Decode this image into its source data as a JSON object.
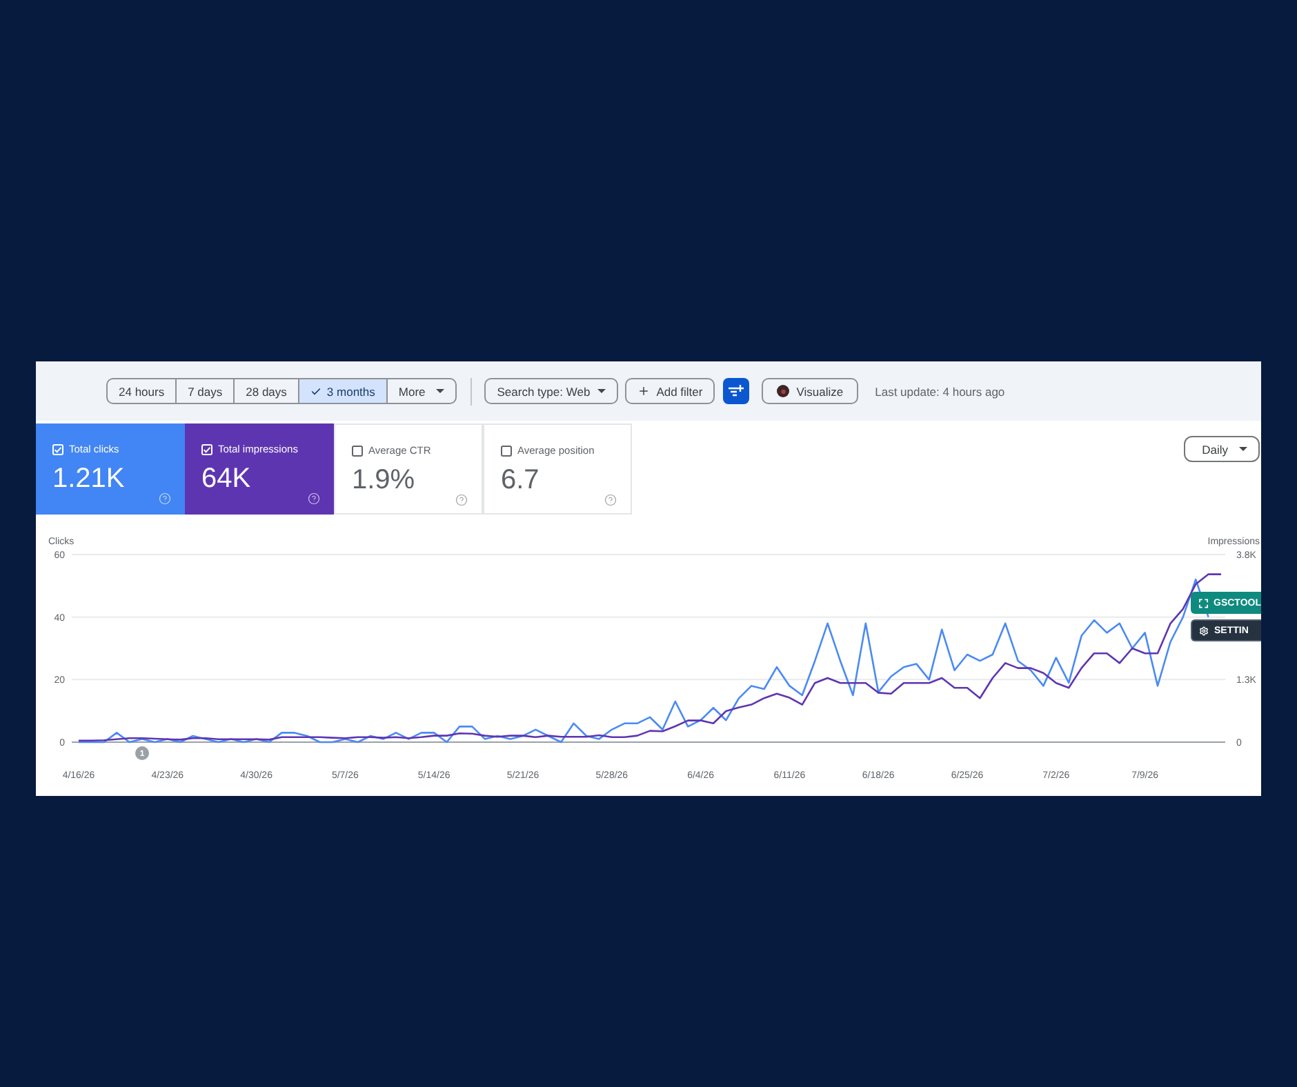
{
  "toolbar": {
    "ranges": [
      {
        "label": "24 hours",
        "selected": false
      },
      {
        "label": "7 days",
        "selected": false
      },
      {
        "label": "28 days",
        "selected": false
      },
      {
        "label": "3 months",
        "selected": true
      }
    ],
    "more": "More",
    "search_type": "Search type: Web",
    "add_filter": "Add filter",
    "visualize": "Visualize",
    "last_update": "Last update: 4 hours ago"
  },
  "metrics": [
    {
      "label": "Total clicks",
      "value": "1.21K",
      "checked": true,
      "color": "#4285f4"
    },
    {
      "label": "Total impressions",
      "value": "64K",
      "checked": true,
      "color": "#5e35b1"
    },
    {
      "label": "Average CTR",
      "value": "1.9%",
      "checked": false
    },
    {
      "label": "Average position",
      "value": "6.7",
      "checked": false
    }
  ],
  "granularity": "Daily",
  "chart": {
    "chart_data": {
      "type": "line",
      "ylabel": "Clicks",
      "y2label": "Impressions",
      "categories": [
        "4/16/26",
        null,
        null,
        null,
        null,
        null,
        null,
        "4/23/26",
        null,
        null,
        null,
        null,
        null,
        null,
        "4/30/26",
        null,
        null,
        null,
        null,
        null,
        null,
        "5/7/26",
        null,
        null,
        null,
        null,
        null,
        null,
        "5/14/26",
        null,
        null,
        null,
        null,
        null,
        null,
        "5/21/26",
        null,
        null,
        null,
        null,
        null,
        null,
        "5/28/26",
        null,
        null,
        null,
        null,
        null,
        null,
        "6/4/26",
        null,
        null,
        null,
        null,
        null,
        null,
        "6/11/26",
        null,
        null,
        null,
        null,
        null,
        null,
        "6/18/26",
        null,
        null,
        null,
        null,
        null,
        null,
        "6/25/26",
        null,
        null,
        null,
        null,
        null,
        null,
        "7/2/26",
        null,
        null,
        null,
        null,
        null,
        null,
        "7/9/26",
        null,
        null,
        null,
        null,
        null,
        null
      ],
      "ylim": [
        0,
        60
      ],
      "yticks": [
        0,
        20,
        40,
        60
      ],
      "y2lim": [
        0,
        3800
      ],
      "y2ticks": [
        {
          "value": 0,
          "label": "0"
        },
        {
          "value": 1267,
          "label": "1.3K"
        },
        {
          "value": 3800,
          "label": "3.8K"
        }
      ],
      "series": [
        {
          "color": "#4a8af4",
          "values": [
            0,
            0,
            0,
            3,
            0,
            1,
            0,
            1,
            0,
            2,
            1,
            0,
            1,
            0,
            1,
            0,
            3,
            3,
            2,
            0,
            0,
            1,
            0,
            2,
            1,
            3,
            1,
            3,
            3,
            0,
            5,
            5,
            1,
            2,
            1,
            2,
            4,
            2,
            0,
            6,
            2,
            1,
            4,
            6,
            6,
            8,
            4,
            13,
            5,
            7,
            11,
            7,
            14,
            18,
            17,
            24,
            18,
            15,
            26,
            38,
            26,
            15,
            38,
            16,
            21,
            24,
            25,
            20,
            36,
            23,
            28,
            26,
            28,
            38,
            26,
            23,
            18,
            27,
            19,
            34,
            39,
            35,
            38,
            30,
            35,
            18,
            32,
            40,
            52,
            40,
            null
          ]
        },
        {
          "axis": "y2",
          "color": "#5e35b1",
          "values": [
            30,
            30,
            40,
            60,
            80,
            80,
            70,
            60,
            50,
            80,
            80,
            60,
            60,
            60,
            60,
            50,
            100,
            100,
            100,
            100,
            90,
            80,
            100,
            100,
            90,
            100,
            80,
            100,
            130,
            130,
            180,
            170,
            130,
            110,
            130,
            130,
            100,
            130,
            110,
            110,
            110,
            140,
            100,
            100,
            130,
            230,
            220,
            320,
            440,
            440,
            380,
            630,
            700,
            760,
            890,
            980,
            900,
            760,
            1200,
            1300,
            1200,
            1200,
            1200,
            1000,
            980,
            1200,
            1200,
            1200,
            1300,
            1100,
            1100,
            890,
            1300,
            1600,
            1500,
            1500,
            1400,
            1200,
            1100,
            1500,
            1800,
            1800,
            1600,
            1900,
            1800,
            1800,
            2400,
            2700,
            3200,
            3400,
            3400
          ]
        }
      ],
      "annotations": [
        "1"
      ]
    }
  },
  "overlay_buttons": [
    {
      "kind": "tool",
      "label": "GSCTOOL"
    },
    {
      "kind": "settings",
      "label": "SETTIN"
    }
  ]
}
